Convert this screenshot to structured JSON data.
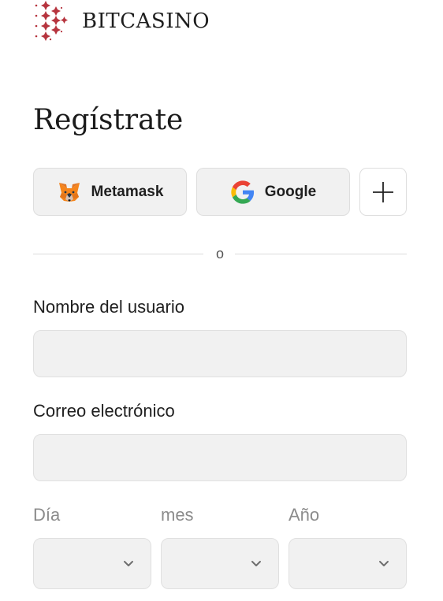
{
  "brand": {
    "name": "BITCASINO",
    "logo_icon": "bitcasino-logo-icon",
    "accent_color": "#b6343e"
  },
  "page": {
    "title": "Regístrate"
  },
  "social": {
    "metamask_label": "Metamask",
    "metamask_icon": "metamask-fox-icon",
    "google_label": "Google",
    "google_icon": "google-g-icon",
    "more_icon": "plus-icon"
  },
  "divider": {
    "text": "o"
  },
  "form": {
    "username": {
      "label": "Nombre del usuario",
      "value": "",
      "placeholder": ""
    },
    "email": {
      "label": "Correo electrónico",
      "value": "",
      "placeholder": ""
    },
    "birthdate": {
      "day_label": "Día",
      "month_label": "mes",
      "year_label": "Año",
      "day_value": "",
      "month_value": "",
      "year_value": "",
      "chevron_icon": "chevron-down-icon"
    }
  }
}
